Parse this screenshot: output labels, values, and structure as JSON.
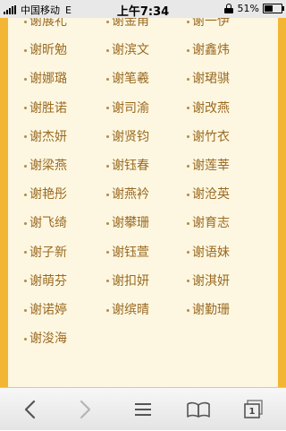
{
  "status_bar": {
    "carrier": "中国移动",
    "network": "E",
    "time": "上午7:34",
    "battery_percent": "51%",
    "battery_level": 0.51
  },
  "names": [
    "谢展礼",
    "谢金甬",
    "谢一伊",
    "谢昕勉",
    "谢滨文",
    "谢鑫炜",
    "谢娜璐",
    "谢笔羲",
    "谢珺骐",
    "谢胜诺",
    "谢司渝",
    "谢改燕",
    "谢杰妍",
    "谢贤钧",
    "谢竹衣",
    "谢梁燕",
    "谢钰春",
    "谢莲莘",
    "谢艳彤",
    "谢燕衿",
    "谢沧英",
    "谢飞绮",
    "谢攀珊",
    "谢育志",
    "谢子新",
    "谢钰萱",
    "谢语妹",
    "谢萌芬",
    "谢扣妍",
    "谢淇妍",
    "谢诺婷",
    "谢缤晴",
    "谢勤珊",
    "谢浚海"
  ],
  "toolbar": {
    "back_icon": "back-icon",
    "forward_icon": "forward-icon",
    "menu_icon": "menu-icon",
    "bookmarks_icon": "bookmarks-icon",
    "tabs_count": "1"
  }
}
